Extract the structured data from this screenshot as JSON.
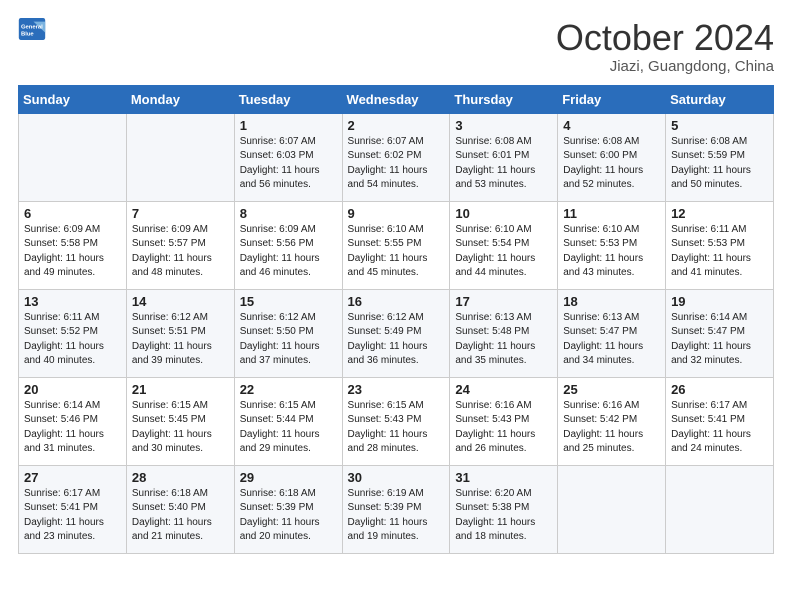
{
  "header": {
    "logo_line1": "General",
    "logo_line2": "Blue",
    "month_title": "October 2024",
    "location": "Jiazi, Guangdong, China"
  },
  "weekdays": [
    "Sunday",
    "Monday",
    "Tuesday",
    "Wednesday",
    "Thursday",
    "Friday",
    "Saturday"
  ],
  "weeks": [
    [
      {
        "day": "",
        "sunrise": "",
        "sunset": "",
        "daylight": ""
      },
      {
        "day": "",
        "sunrise": "",
        "sunset": "",
        "daylight": ""
      },
      {
        "day": "1",
        "sunrise": "Sunrise: 6:07 AM",
        "sunset": "Sunset: 6:03 PM",
        "daylight": "Daylight: 11 hours and 56 minutes."
      },
      {
        "day": "2",
        "sunrise": "Sunrise: 6:07 AM",
        "sunset": "Sunset: 6:02 PM",
        "daylight": "Daylight: 11 hours and 54 minutes."
      },
      {
        "day": "3",
        "sunrise": "Sunrise: 6:08 AM",
        "sunset": "Sunset: 6:01 PM",
        "daylight": "Daylight: 11 hours and 53 minutes."
      },
      {
        "day": "4",
        "sunrise": "Sunrise: 6:08 AM",
        "sunset": "Sunset: 6:00 PM",
        "daylight": "Daylight: 11 hours and 52 minutes."
      },
      {
        "day": "5",
        "sunrise": "Sunrise: 6:08 AM",
        "sunset": "Sunset: 5:59 PM",
        "daylight": "Daylight: 11 hours and 50 minutes."
      }
    ],
    [
      {
        "day": "6",
        "sunrise": "Sunrise: 6:09 AM",
        "sunset": "Sunset: 5:58 PM",
        "daylight": "Daylight: 11 hours and 49 minutes."
      },
      {
        "day": "7",
        "sunrise": "Sunrise: 6:09 AM",
        "sunset": "Sunset: 5:57 PM",
        "daylight": "Daylight: 11 hours and 48 minutes."
      },
      {
        "day": "8",
        "sunrise": "Sunrise: 6:09 AM",
        "sunset": "Sunset: 5:56 PM",
        "daylight": "Daylight: 11 hours and 46 minutes."
      },
      {
        "day": "9",
        "sunrise": "Sunrise: 6:10 AM",
        "sunset": "Sunset: 5:55 PM",
        "daylight": "Daylight: 11 hours and 45 minutes."
      },
      {
        "day": "10",
        "sunrise": "Sunrise: 6:10 AM",
        "sunset": "Sunset: 5:54 PM",
        "daylight": "Daylight: 11 hours and 44 minutes."
      },
      {
        "day": "11",
        "sunrise": "Sunrise: 6:10 AM",
        "sunset": "Sunset: 5:53 PM",
        "daylight": "Daylight: 11 hours and 43 minutes."
      },
      {
        "day": "12",
        "sunrise": "Sunrise: 6:11 AM",
        "sunset": "Sunset: 5:53 PM",
        "daylight": "Daylight: 11 hours and 41 minutes."
      }
    ],
    [
      {
        "day": "13",
        "sunrise": "Sunrise: 6:11 AM",
        "sunset": "Sunset: 5:52 PM",
        "daylight": "Daylight: 11 hours and 40 minutes."
      },
      {
        "day": "14",
        "sunrise": "Sunrise: 6:12 AM",
        "sunset": "Sunset: 5:51 PM",
        "daylight": "Daylight: 11 hours and 39 minutes."
      },
      {
        "day": "15",
        "sunrise": "Sunrise: 6:12 AM",
        "sunset": "Sunset: 5:50 PM",
        "daylight": "Daylight: 11 hours and 37 minutes."
      },
      {
        "day": "16",
        "sunrise": "Sunrise: 6:12 AM",
        "sunset": "Sunset: 5:49 PM",
        "daylight": "Daylight: 11 hours and 36 minutes."
      },
      {
        "day": "17",
        "sunrise": "Sunrise: 6:13 AM",
        "sunset": "Sunset: 5:48 PM",
        "daylight": "Daylight: 11 hours and 35 minutes."
      },
      {
        "day": "18",
        "sunrise": "Sunrise: 6:13 AM",
        "sunset": "Sunset: 5:47 PM",
        "daylight": "Daylight: 11 hours and 34 minutes."
      },
      {
        "day": "19",
        "sunrise": "Sunrise: 6:14 AM",
        "sunset": "Sunset: 5:47 PM",
        "daylight": "Daylight: 11 hours and 32 minutes."
      }
    ],
    [
      {
        "day": "20",
        "sunrise": "Sunrise: 6:14 AM",
        "sunset": "Sunset: 5:46 PM",
        "daylight": "Daylight: 11 hours and 31 minutes."
      },
      {
        "day": "21",
        "sunrise": "Sunrise: 6:15 AM",
        "sunset": "Sunset: 5:45 PM",
        "daylight": "Daylight: 11 hours and 30 minutes."
      },
      {
        "day": "22",
        "sunrise": "Sunrise: 6:15 AM",
        "sunset": "Sunset: 5:44 PM",
        "daylight": "Daylight: 11 hours and 29 minutes."
      },
      {
        "day": "23",
        "sunrise": "Sunrise: 6:15 AM",
        "sunset": "Sunset: 5:43 PM",
        "daylight": "Daylight: 11 hours and 28 minutes."
      },
      {
        "day": "24",
        "sunrise": "Sunrise: 6:16 AM",
        "sunset": "Sunset: 5:43 PM",
        "daylight": "Daylight: 11 hours and 26 minutes."
      },
      {
        "day": "25",
        "sunrise": "Sunrise: 6:16 AM",
        "sunset": "Sunset: 5:42 PM",
        "daylight": "Daylight: 11 hours and 25 minutes."
      },
      {
        "day": "26",
        "sunrise": "Sunrise: 6:17 AM",
        "sunset": "Sunset: 5:41 PM",
        "daylight": "Daylight: 11 hours and 24 minutes."
      }
    ],
    [
      {
        "day": "27",
        "sunrise": "Sunrise: 6:17 AM",
        "sunset": "Sunset: 5:41 PM",
        "daylight": "Daylight: 11 hours and 23 minutes."
      },
      {
        "day": "28",
        "sunrise": "Sunrise: 6:18 AM",
        "sunset": "Sunset: 5:40 PM",
        "daylight": "Daylight: 11 hours and 21 minutes."
      },
      {
        "day": "29",
        "sunrise": "Sunrise: 6:18 AM",
        "sunset": "Sunset: 5:39 PM",
        "daylight": "Daylight: 11 hours and 20 minutes."
      },
      {
        "day": "30",
        "sunrise": "Sunrise: 6:19 AM",
        "sunset": "Sunset: 5:39 PM",
        "daylight": "Daylight: 11 hours and 19 minutes."
      },
      {
        "day": "31",
        "sunrise": "Sunrise: 6:20 AM",
        "sunset": "Sunset: 5:38 PM",
        "daylight": "Daylight: 11 hours and 18 minutes."
      },
      {
        "day": "",
        "sunrise": "",
        "sunset": "",
        "daylight": ""
      },
      {
        "day": "",
        "sunrise": "",
        "sunset": "",
        "daylight": ""
      }
    ]
  ]
}
